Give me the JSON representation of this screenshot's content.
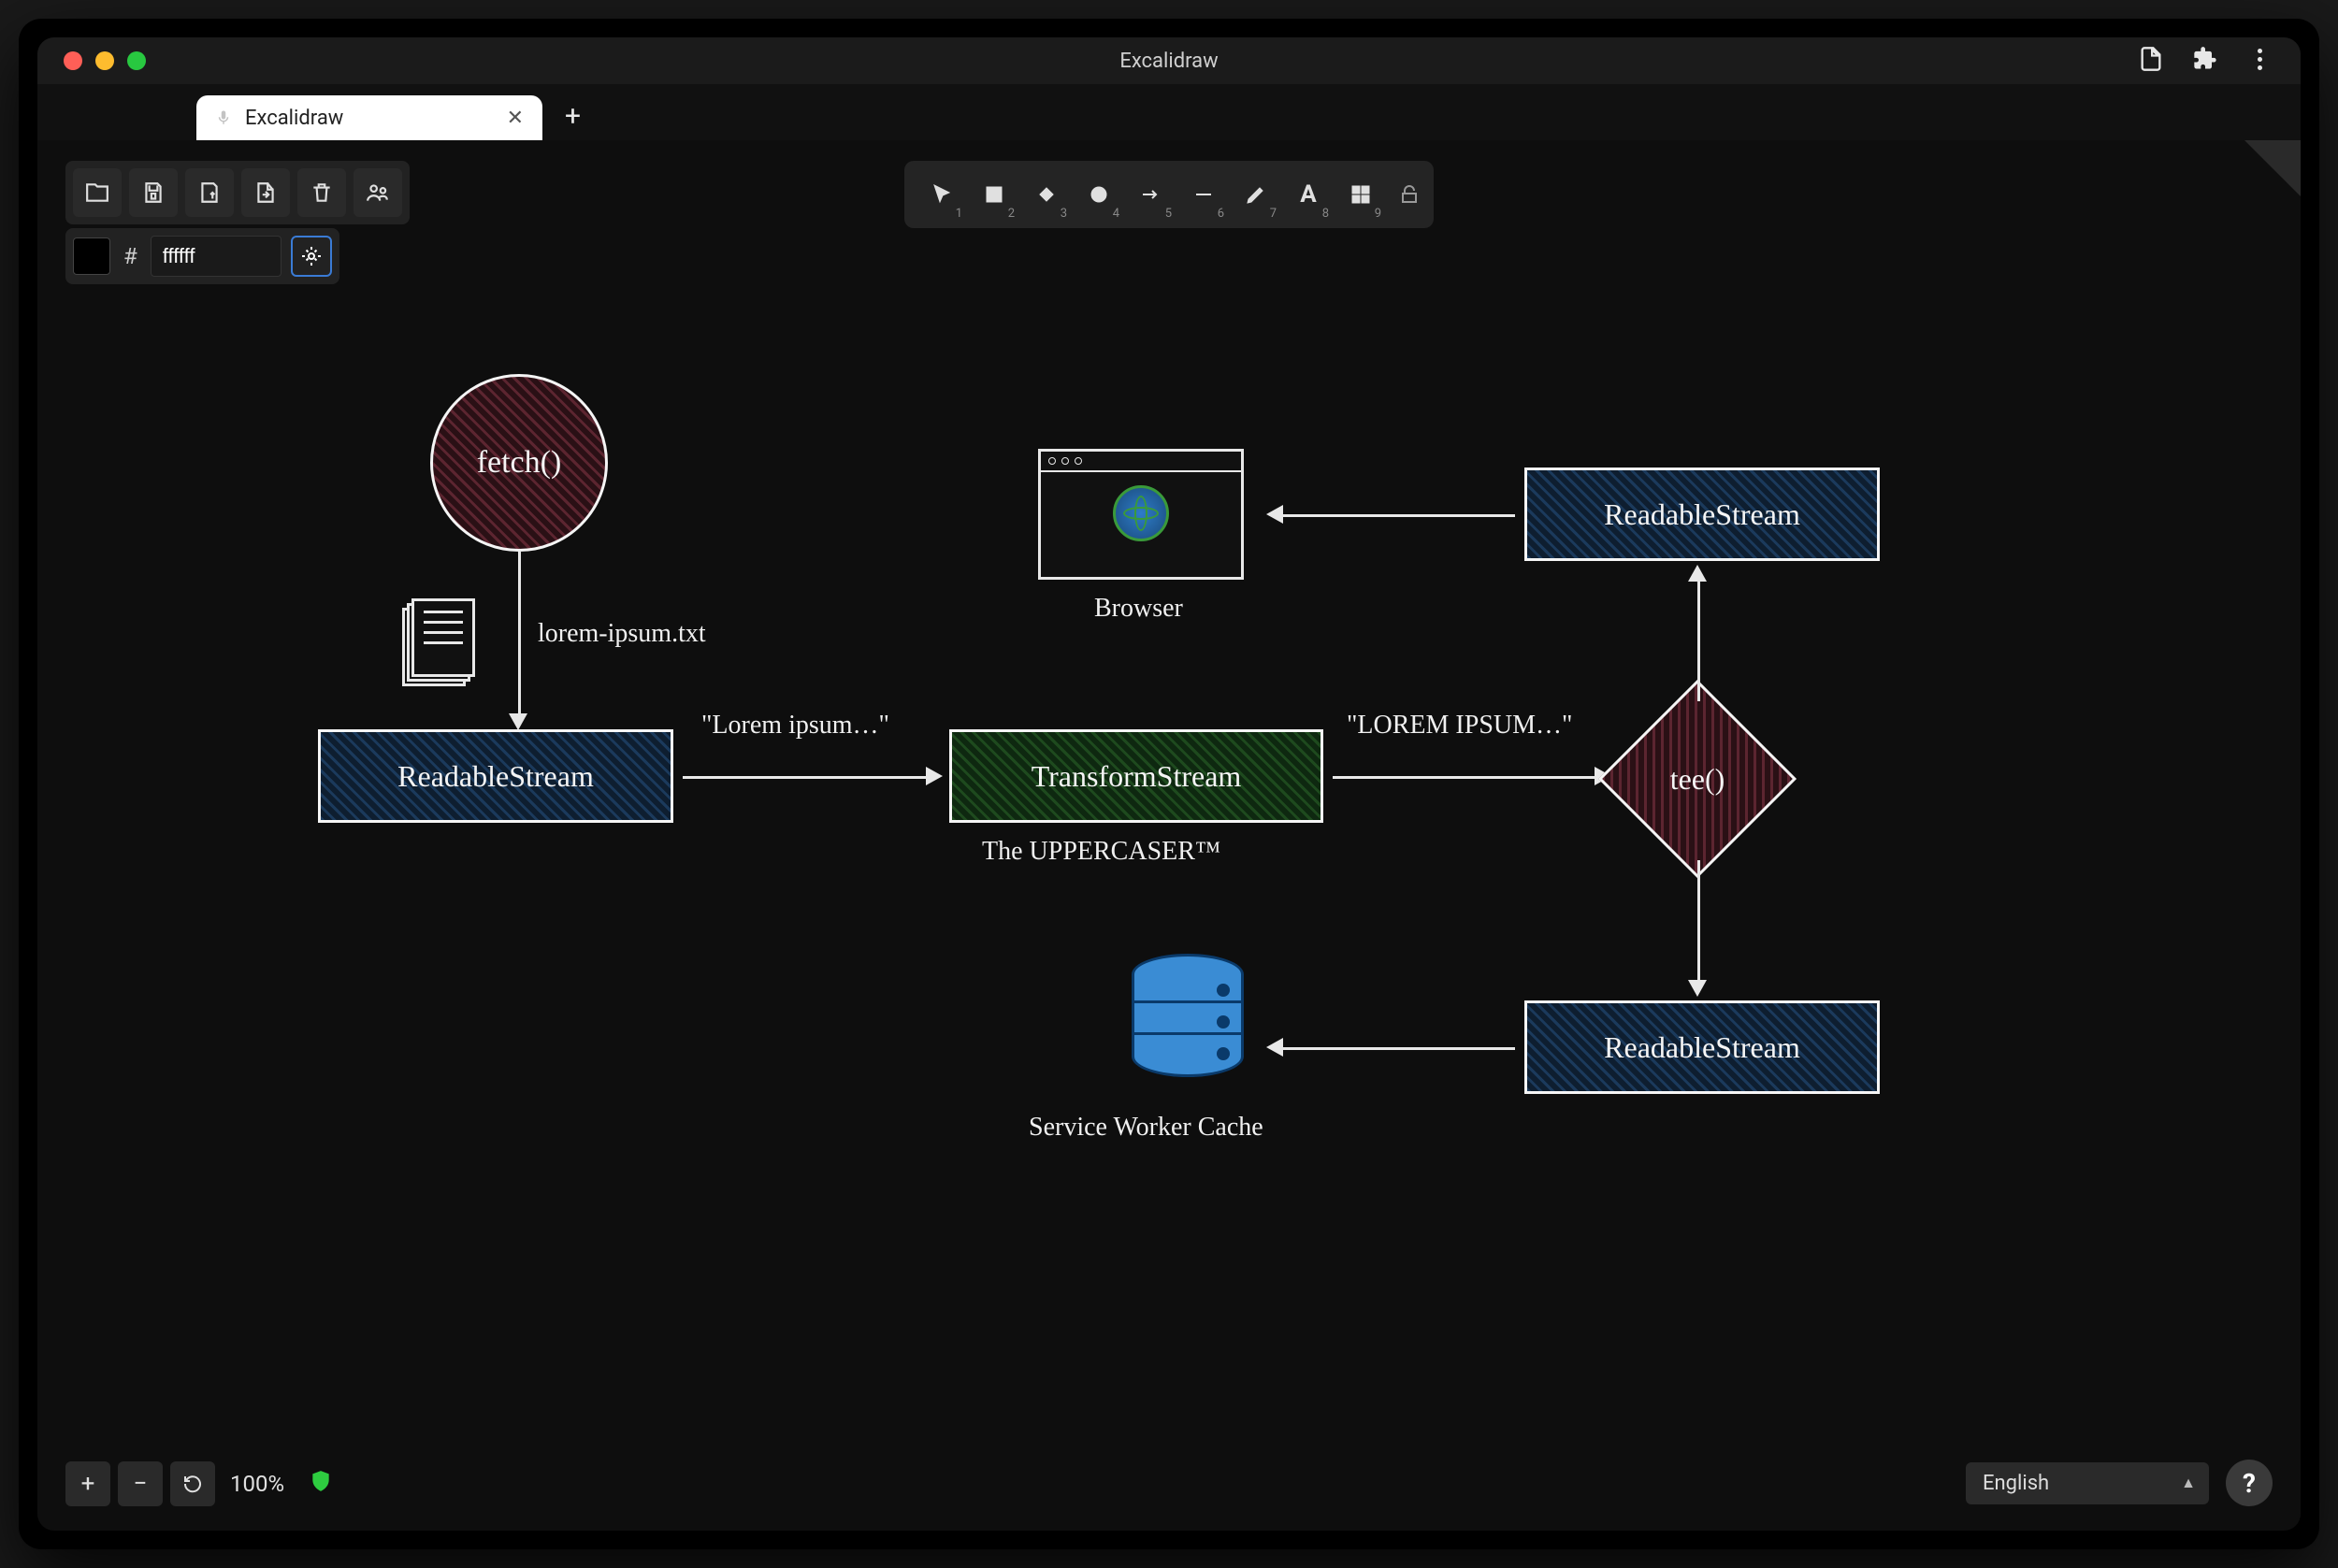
{
  "window": {
    "title": "Excalidraw",
    "tab_label": "Excalidraw"
  },
  "color": {
    "hex": "ffffff"
  },
  "tools": {
    "keys": [
      "1",
      "2",
      "3",
      "4",
      "5",
      "6",
      "7",
      "8",
      "9"
    ]
  },
  "zoom": {
    "percent": "100%"
  },
  "language": {
    "selected": "English"
  },
  "diagram": {
    "fetch_label": "fetch()",
    "file_label": "lorem-ipsum.txt",
    "readable1": "ReadableStream",
    "arrow1_label": "\"Lorem ipsum…\"",
    "transform": "TransformStream",
    "transform_caption": "The UPPERCASER™",
    "arrow2_label": "\"LOREM IPSUM…\"",
    "tee": "tee()",
    "readable_top": "ReadableStream",
    "readable_bottom": "ReadableStream",
    "browser_caption": "Browser",
    "sw_caption": "Service Worker Cache"
  }
}
